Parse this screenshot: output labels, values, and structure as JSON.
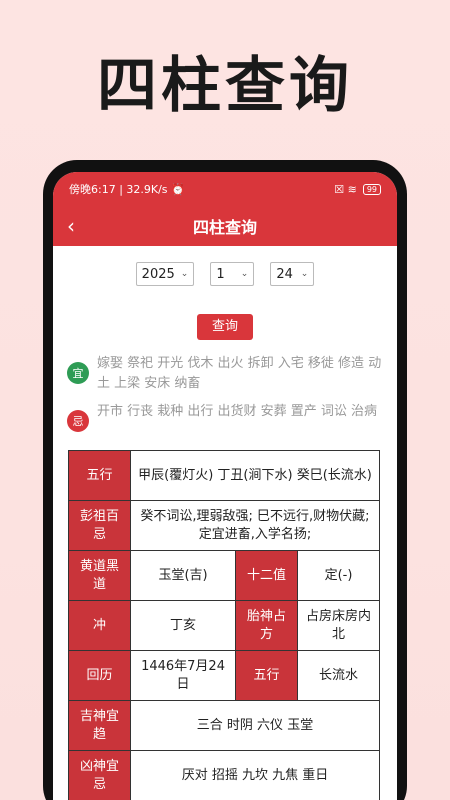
{
  "hero_title": "四柱查询",
  "status": {
    "left": "傍晚6:17 | 32.9K/s ⏰",
    "right_icons": "☒ ≋",
    "battery": "99"
  },
  "nav": {
    "back": "‹",
    "title": "四柱查询"
  },
  "selectors": {
    "year": "2025",
    "month": "1",
    "day": "24",
    "chevron": "⌄"
  },
  "query_button": "查询",
  "yi": {
    "badge": "宜",
    "text": "嫁娶 祭祀 开光 伐木 出火 拆卸 入宅 移徙 修造 动土 上梁 安床 纳畜"
  },
  "ji": {
    "badge": "忌",
    "text": "开市 行丧 栽种 出行 出货财 安葬 置产 词讼 治病"
  },
  "table": {
    "wuxing_label": "五行",
    "wuxing_value": "甲辰(覆灯火) 丁丑(涧下水) 癸巳(长流水)",
    "pengzu_label": "彭祖百忌",
    "pengzu_value": "癸不词讼,理弱敌强; 巳不远行,财物伏藏; 定宜进畜,入学名扬;",
    "huangdao_label": "黄道黑道",
    "huangdao_value": "玉堂(吉)",
    "shierzhi_label": "十二值",
    "shierzhi_value": "定(-)",
    "chong_label": "冲",
    "chong_value": "丁亥",
    "taishen_label": "胎神占方",
    "taishen_value": "占房床房内北",
    "huili_label": "回历",
    "huili_value": "1446年7月24日",
    "wuxing2_label": "五行",
    "wuxing2_value": "长流水",
    "jishen_label": "吉神宜趋",
    "jishen_value": "三合 时阴 六仪 玉堂",
    "xiongshen_label": "凶神宜忌",
    "xiongshen_value": "厌对 招摇 九坎 九焦 重日"
  }
}
